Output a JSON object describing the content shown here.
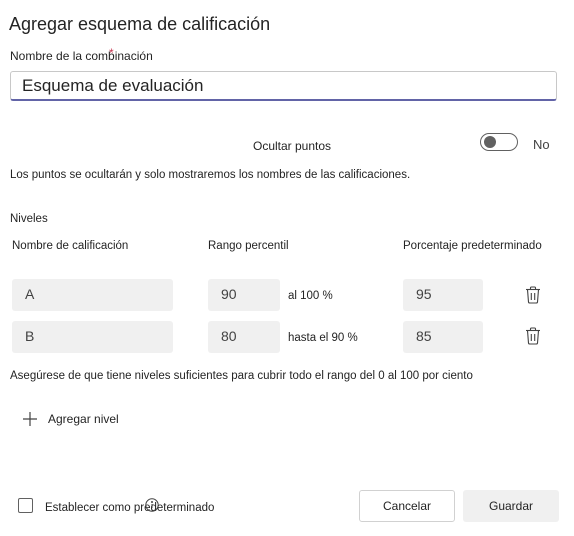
{
  "dialog": {
    "title": "Agregar esquema de calificación",
    "name_label": "Nombre de la combinación",
    "required_mark": "*",
    "name_value": "Esquema de evaluación"
  },
  "hide_points": {
    "label": "Ocultar puntos",
    "state": "No",
    "enabled": false,
    "description": "Los puntos se ocultarán y solo mostraremos los nombres de las calificaciones."
  },
  "levels": {
    "label": "Niveles",
    "columns": [
      "Nombre de calificación",
      "Rango percentil",
      "Porcentaje predeterminado"
    ],
    "rows": [
      {
        "grade": "A",
        "percentile": "90",
        "range_text": "al 100 %",
        "default_pct": "95"
      },
      {
        "grade": "B",
        "percentile": "80",
        "range_text": "hasta el 90 %",
        "default_pct": "85"
      }
    ],
    "warning": "Asegúrese de que tiene niveles suficientes para cubrir todo el rango del 0 al 100 por ciento",
    "add_label": "Agregar nivel"
  },
  "footer": {
    "default_label": "Establecer como predeterminado",
    "cancel_label": "Cancelar",
    "save_label": "Guardar"
  },
  "icons": {
    "add": "plus-icon",
    "delete": "trash-icon",
    "info": "info-icon"
  },
  "colors": {
    "accent": "#6264a7",
    "required": "#c4314b"
  }
}
